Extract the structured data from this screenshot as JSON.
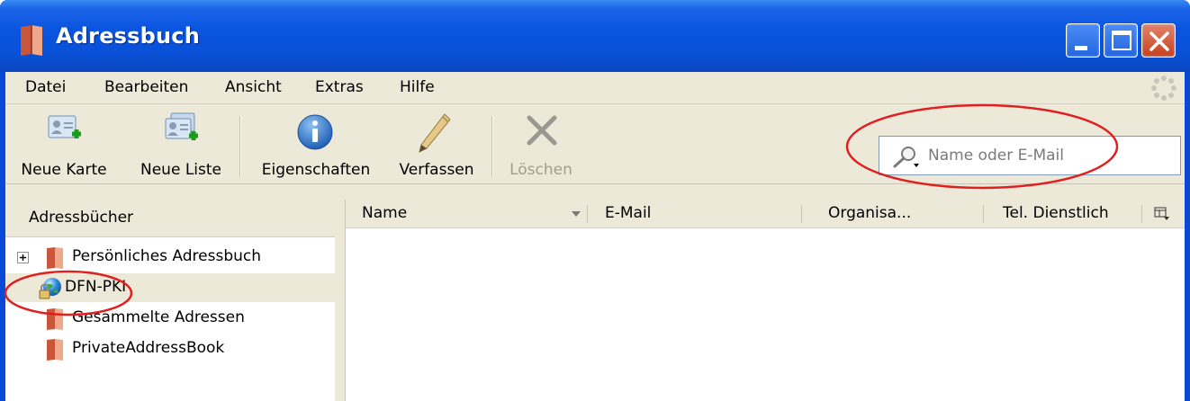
{
  "window": {
    "title": "Adressbuch"
  },
  "menu": {
    "items": [
      {
        "label": "Datei"
      },
      {
        "label": "Bearbeiten"
      },
      {
        "label": "Ansicht"
      },
      {
        "label": "Extras"
      },
      {
        "label": "Hilfe"
      }
    ]
  },
  "toolbar": {
    "buttons": [
      {
        "label": "Neue Karte",
        "icon": "new-card-icon",
        "enabled": true
      },
      {
        "label": "Neue Liste",
        "icon": "new-list-icon",
        "enabled": true
      },
      {
        "label": "Eigenschaften",
        "icon": "info-icon",
        "enabled": true
      },
      {
        "label": "Verfassen",
        "icon": "pencil-icon",
        "enabled": true
      },
      {
        "label": "Löschen",
        "icon": "delete-icon",
        "enabled": false
      }
    ]
  },
  "search": {
    "placeholder": "Name oder E-Mail",
    "value": ""
  },
  "addressbooks": {
    "header": "Adressbücher",
    "items": [
      {
        "label": "Persönliches Adressbuch",
        "icon": "address-book-icon",
        "expandable": true,
        "selected": false
      },
      {
        "label": "DFN-PKI",
        "icon": "ldap-directory-icon",
        "expandable": false,
        "selected": true
      },
      {
        "label": "Gesammelte Adressen",
        "icon": "address-book-icon",
        "expandable": false,
        "selected": false
      },
      {
        "label": "PrivateAddressBook",
        "icon": "address-book-icon",
        "expandable": false,
        "selected": false
      }
    ]
  },
  "contacts": {
    "columns": [
      {
        "label": "Name"
      },
      {
        "label": "E-Mail"
      },
      {
        "label": "Organisa..."
      },
      {
        "label": "Tel. Dienstlich"
      }
    ],
    "rows": []
  },
  "colors": {
    "titlebar": "#0a55e0",
    "chrome": "#ece9d8",
    "annotation": "#e02020"
  }
}
